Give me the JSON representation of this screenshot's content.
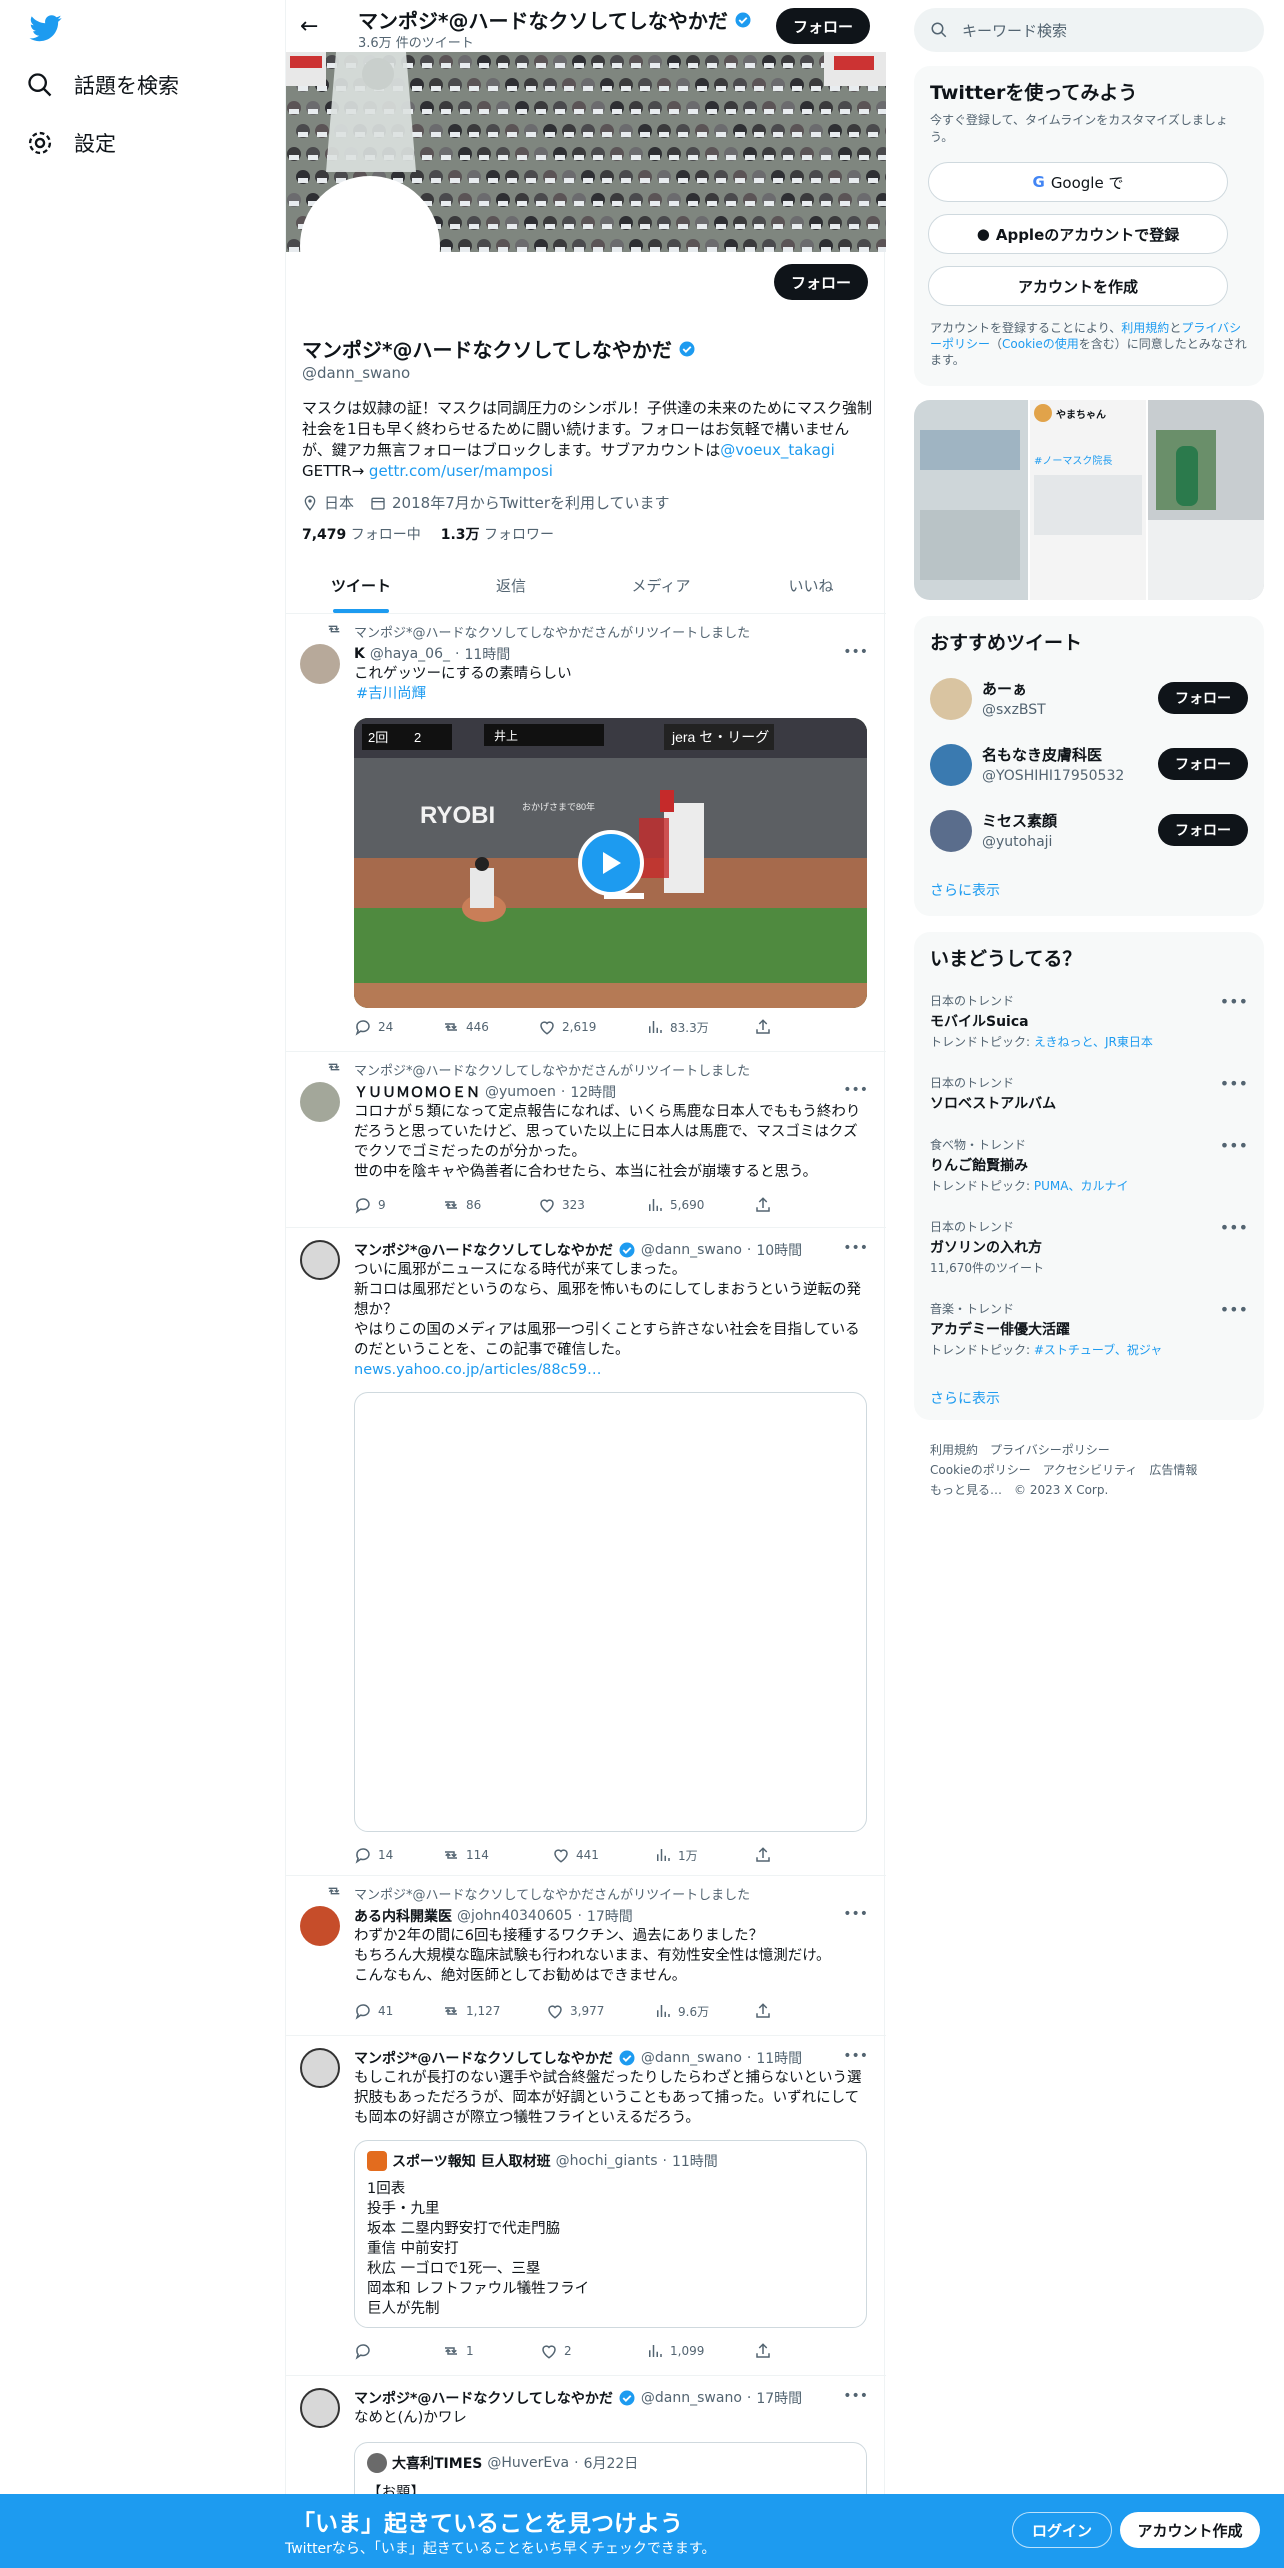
{
  "nav": {
    "explore": "話題を検索",
    "settings": "設定"
  },
  "profile": {
    "name": "マンポジ*@ハードなクソしてしなやかだ",
    "tweet_count": "3.6万 件のツイート",
    "follow_label": "フォロー",
    "handle": "@dann_swano",
    "bio_1": "マスクは奴隷の証！マスクは同調圧力のシンボル！子供達の未来のためにマスク強制社会を1日も早く終わらせるために闘い続けます。フォローはお気軽で構いませんが、鍵アカ無言フォローはブロックします。サブアカウントは",
    "bio_link": "@voeux_takagi",
    "bio_2": "GETTR→ ",
    "bio_link2": "gettr.com/user/mamposi",
    "location": "日本",
    "joined": "2018年7月からTwitterを利用しています",
    "following_count": "7,479",
    "following_label": "フォロー中",
    "followers_count": "1.3万",
    "followers_label": "フォロワー",
    "tabs": [
      "ツイート",
      "返信",
      "メディア",
      "いいね"
    ]
  },
  "tweets": [
    {
      "rt": "マンポジ*@ハードなクソしてしなやかださんがリツイートしました",
      "name": "K",
      "handle": "@haya_06_",
      "time": "11時間",
      "text": "これゲッツーにするの素晴らしい",
      "hashtag": "#吉川尚輝",
      "score_1": "2回",
      "score_2": "2",
      "batter": "井上",
      "sponsor": "おかげさまで80年",
      "ad": "jera セ・リーグ",
      "ryobi": "RYOBI",
      "replies": "24",
      "retweets": "446",
      "likes": "2,619",
      "views": "83.3万"
    },
    {
      "rt": "マンポジ*@ハードなクソしてしなやかださんがリツイートしました",
      "name": "ＹＵＵＭＯＭＯＥＮ",
      "handle": "@yumoen",
      "time": "12時間",
      "text": "コロナが５類になって定点報告になれば、いくら馬鹿な日本人でももう終わりだろうと思っていたけど、思っていた以上に日本人は馬鹿で、マスゴミはクズでクソでゴミだったのが分かった。\n世の中を陰キャや偽善者に合わせたら、本当に社会が崩壊すると思う。",
      "replies": "9",
      "retweets": "86",
      "likes": "323",
      "views": "5,690"
    },
    {
      "name": "マンポジ*@ハードなクソしてしなやかだ",
      "handle": "@dann_swano",
      "time": "10時間",
      "text": "ついに風邪がニュースになる時代が来てしまった。\n新コロは風邪だというのなら、風邪を怖いものにしてしまおうという逆転の発想か？\nやはりこの国のメディアは風邪一つ引くことすら許さない社会を目指しているのだということを、この記事で確信した。",
      "link": "news.yahoo.co.jp/articles/88c59…",
      "replies": "14",
      "retweets": "114",
      "likes": "441",
      "views": "1万"
    },
    {
      "rt": "マンポジ*@ハードなクソしてしなやかださんがリツイートしました",
      "name": "ある内科開業医",
      "handle": "@john40340605",
      "time": "17時間",
      "text": "わずか2年の間に6回も接種するワクチン、過去にありました？\nもちろん大規模な臨床試験も行われないまま、有効性安全性は憶測だけ。\nこんなもん、絶対医師としてお勧めはできません。",
      "replies": "41",
      "retweets": "1,127",
      "likes": "3,977",
      "views": "9.6万"
    },
    {
      "name": "マンポジ*@ハードなクソしてしなやかだ",
      "handle": "@dann_swano",
      "time": "11時間",
      "text": "もしこれが長打のない選手や試合終盤だったりしたらわざと捕らないという選択肢もあっただろうが、岡本が好調ということもあって捕った。いずれにしても岡本の好調さが際立つ犠牲フライといえるだろう。",
      "quote_name": "スポーツ報知 巨人取材班",
      "quote_handle": "@hochi_giants",
      "quote_time": "11時間",
      "quote_text": "1回表\n投手・九里\n坂本 二塁内野安打で代走門脇\n重信 中前安打\n秋広 一ゴロで1死一、三塁\n岡本和 レフトファウル犠牲フライ\n巨人が先制",
      "replies": "",
      "retweets": "1",
      "likes": "2",
      "views": "1,099"
    },
    {
      "name": "マンポジ*@ハードなクソしてしなやかだ",
      "handle": "@dann_swano",
      "time": "17時間",
      "text": "なめと(ん)かワレ",
      "quote_name": "大喜利TIMES",
      "quote_handle": "@HuverEva",
      "quote_time": "6月22日",
      "quote_text": "【お題】"
    }
  ],
  "right": {
    "search_placeholder": "キーワード検索",
    "signup_title": "Twitterを使ってみよう",
    "signup_sub": "今すぐ登録して、タイムラインをカスタマイズしましょう。",
    "google_btn": "Google で",
    "apple_btn": "Appleのアカウントで登録",
    "create_btn": "アカウントを作成",
    "terms_1": "アカウントを登録することにより、",
    "terms_link1": "利用規約",
    "terms_2": "と",
    "terms_link2": "プライバシーポリシー",
    "terms_3": "（",
    "terms_link3": "Cookieの使用",
    "terms_4": "を含む）に同意したとみなされます。",
    "media_name": "やまちゃん",
    "media_text": "#ノーマスク院長",
    "rec_title": "おすすめツイート",
    "recs": [
      {
        "name": "あーぁ",
        "handle": "@sxzBST",
        "btn": "フォロー"
      },
      {
        "name": "名もなき皮膚科医",
        "handle": "@YOSHIHI17950532",
        "btn": "フォロー"
      },
      {
        "name": "ミセス素顔",
        "handle": "@yutohaji",
        "btn": "フォロー"
      }
    ],
    "show_more": "さらに表示",
    "trends_title": "いまどうしてる？",
    "trends": [
      {
        "ctx": "日本のトレンド",
        "name": "モバイルSuica",
        "sub_label": "トレンドトピック: ",
        "sub_links": "えきねっと、JR東日本"
      },
      {
        "ctx": "日本のトレンド",
        "name": "ソロベストアルバム",
        "sub_label": "",
        "sub_links": ""
      },
      {
        "ctx": "食べ物・トレンド",
        "name": "りんご飴賢揃み",
        "sub_label": "トレンドトピック: ",
        "sub_links": "PUMA、カルナイ"
      },
      {
        "ctx": "日本のトレンド",
        "name": "ガソリンの入れ方",
        "sub_label": "11,670件のツイート",
        "sub_links": ""
      },
      {
        "ctx": "音楽・トレンド",
        "name": "アカデミー俳優大活躍",
        "sub_label": "トレンドトピック: ",
        "sub_links": "#ストチューブ、祝ジャ"
      }
    ],
    "footer_1": "利用規約　プライバシーポリシー",
    "footer_2": "Cookieのポリシー　アクセシビリティ　広告情報",
    "footer_3": "もっと見る…　© 2023 X Corp."
  },
  "bottom": {
    "title": "「いま」起きていることを見つけよう",
    "sub": "Twitterなら、「いま」起きていることをいち早くチェックできます。",
    "login": "ログイン",
    "signup": "アカウント作成"
  },
  "colors": {
    "accent": "#1d9bf0",
    "text": "#0f1419",
    "muted": "#536471"
  }
}
